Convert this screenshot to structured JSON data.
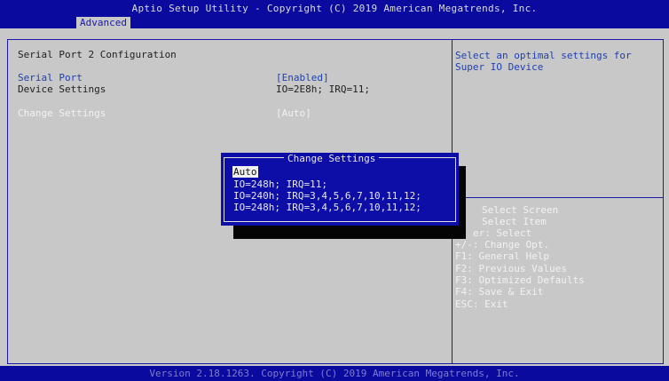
{
  "header": {
    "title": "Aptio Setup Utility - Copyright (C) 2019 American Megatrends, Inc.",
    "active_tab": "Advanced"
  },
  "main": {
    "section_title": "Serial Port 2 Configuration",
    "items": [
      {
        "label": "Serial Port",
        "value": "[Enabled]"
      },
      {
        "label": "Device Settings",
        "value": "IO=2E8h; IRQ=11;"
      },
      {
        "label": "Change Settings",
        "value": "[Auto]"
      }
    ]
  },
  "help": {
    "line1": "Select an optimal settings for",
    "line2": "Super IO Device"
  },
  "keys": [
    "Select Screen",
    "Select Item",
    "er: Select",
    "+/-: Change Opt.",
    "F1: General Help",
    "F2: Previous Values",
    "F3: Optimized Defaults",
    "F4: Save & Exit",
    "ESC: Exit"
  ],
  "popup": {
    "title": "Change Settings",
    "options": [
      "Auto",
      "IO=248h; IRQ=11;",
      "IO=240h; IRQ=3,4,5,6,7,10,11,12;",
      "IO=248h; IRQ=3,4,5,6,7,10,11,12;"
    ]
  },
  "footer": {
    "text": "Version 2.18.1263. Copyright (C) 2019 American Megatrends, Inc."
  },
  "colors": {
    "bar_blue": "#0a0a9e",
    "background_gray": "#c8c8c8",
    "popup_blue": "#0d0da8",
    "item_blue": "#1e3fb0"
  }
}
